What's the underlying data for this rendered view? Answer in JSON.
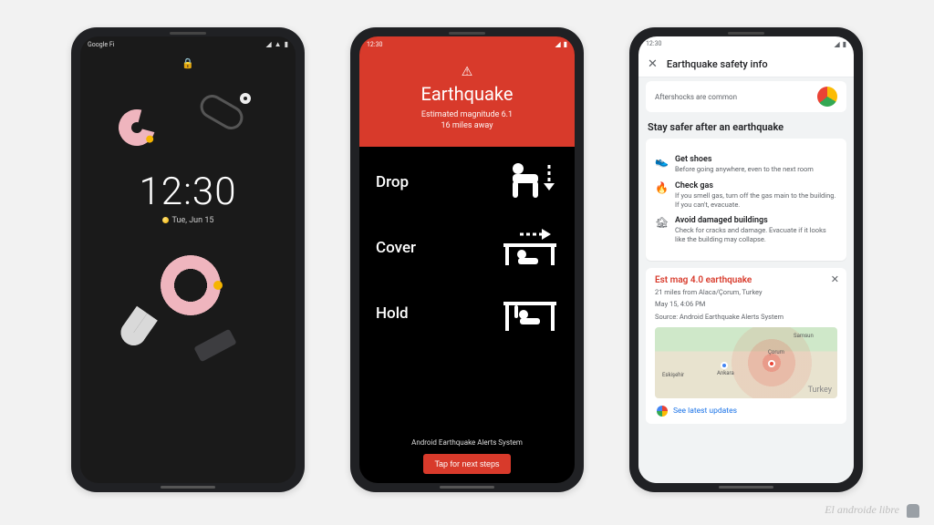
{
  "watermark": "El androide libre",
  "phone1": {
    "carrier": "Google Fi",
    "time": "12:30",
    "date": "Tue, Jun 15"
  },
  "phone2": {
    "time": "12:30",
    "title": "Earthquake",
    "magnitude": "Estimated magnitude 6.1",
    "distance": "16 miles away",
    "steps": {
      "drop": "Drop",
      "cover": "Cover",
      "hold": "Hold"
    },
    "system": "Android Earthquake Alerts System",
    "cta": "Tap for next steps"
  },
  "phone3": {
    "time": "12:30",
    "header": "Earthquake safety info",
    "aftershock": "Aftershocks are common",
    "section": "Stay safer after an earthquake",
    "tips": {
      "shoes": {
        "title": "Get shoes",
        "desc": "Before going anywhere, even to the next room"
      },
      "gas": {
        "title": "Check gas",
        "desc": "If you smell gas, turn off the gas main to the building. If you can't, evacuate."
      },
      "bldg": {
        "title": "Avoid damaged buildings",
        "desc": "Check for cracks and damage. Evacuate if it looks like the building may collapse."
      }
    },
    "quake": {
      "title": "Est mag 4.0 earthquake",
      "loc": "21 miles from Alaca/Çorum, Turkey",
      "when": "May 15, 4:06 PM",
      "source": "Source: Android Earthquake Alerts System"
    },
    "map": {
      "ankara": "Ankara",
      "corum": "Çorum",
      "samsun": "Samsun",
      "eskisehir": "Eskişehir",
      "country": "Turkey"
    },
    "latest": "See latest updates"
  }
}
